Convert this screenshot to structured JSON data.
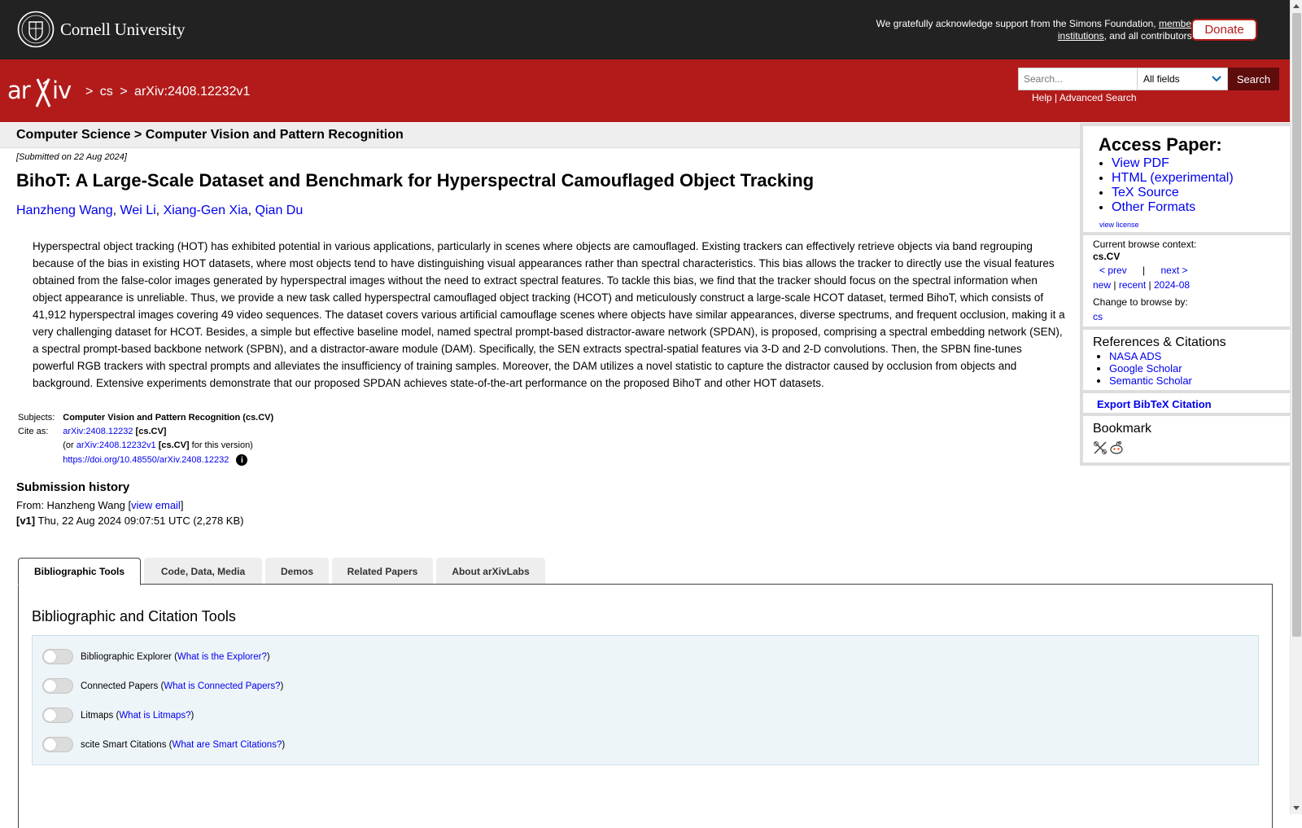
{
  "cornell": {
    "name": "Cornell University",
    "ack_prefix": "We gratefully acknowledge support from the Simons Foundation,",
    "ack_link": "member institutions",
    "ack_suffix": ", and all contributors.",
    "donate_label": "Donate"
  },
  "header": {
    "crumb_sep": ">",
    "crumb_cs": "cs",
    "crumb_id": "arXiv:2408.12232v1",
    "search_placeholder": "Search...",
    "search_field": "All fields",
    "search_button": "Search",
    "help": "Help",
    "help_sep": "|",
    "advanced": "Advanced Search"
  },
  "subheader": {
    "title": "Computer Science > Computer Vision and Pattern Recognition"
  },
  "paper": {
    "dateline": "[Submitted on 22 Aug 2024]",
    "title": "BihoT: A Large-Scale Dataset and Benchmark for Hyperspectral Camouflaged Object Tracking",
    "authors": [
      "Hanzheng Wang",
      "Wei Li",
      "Xiang-Gen Xia",
      "Qian Du"
    ],
    "author_sep": ",",
    "abstract": "Hyperspectral object tracking (HOT) has exhibited potential in various applications, particularly in scenes where objects are camouflaged. Existing trackers can effectively retrieve objects via band regrouping because of the bias in existing HOT datasets, where most objects tend to have distinguishing visual appearances rather than spectral characteristics. This bias allows the tracker to directly use the visual features obtained from the false-color images generated by hyperspectral images without the need to extract spectral features. To tackle this bias, we find that the tracker should focus on the spectral information when object appearance is unreliable. Thus, we provide a new task called hyperspectral camouflaged object tracking (HCOT) and meticulously construct a large-scale HCOT dataset, termed BihoT, which consists of 41,912 hyperspectral images covering 49 video sequences. The dataset covers various artificial camouflage scenes where objects have similar appearances, diverse spectrums, and frequent occlusion, making it a very challenging dataset for HCOT. Besides, a simple but effective baseline model, named spectral prompt-based distractor-aware network (SPDAN), is proposed, comprising a spectral embedding network (SEN), a spectral prompt-based backbone network (SPBN), and a distractor-aware module (DAM). Specifically, the SEN extracts spectral-spatial features via 3-D and 2-D convolutions. Then, the SPBN fine-tunes powerful RGB trackers with spectral prompts and alleviates the insufficiency of training samples. Moreover, the DAM utilizes a novel statistic to capture the distractor caused by occlusion from objects and background. Extensive experiments demonstrate that our proposed SPDAN achieves state-of-the-art performance on the proposed BihoT and other HOT datasets.",
    "subjects_label": "Subjects:",
    "subjects_value": "Computer Vision and Pattern Recognition (cs.CV)",
    "cite_label": "Cite as:",
    "cite_id": "arXiv:2408.12232",
    "cite_cat": "[cs.CV]",
    "cite_or_prefix": "(or",
    "cite_version_id": "arXiv:2408.12232v1",
    "cite_version_cat": "[cs.CV]",
    "cite_version_suffix": "for this version)",
    "doi": "https://doi.org/10.48550/arXiv.2408.12232",
    "history_title": "Submission history",
    "from_prefix": "From: Hanzheng Wang [",
    "view_email": "view email",
    "from_suffix": "]",
    "v1_tag": "[v1]",
    "v1_text": "Thu, 22 Aug 2024 09:07:51 UTC (2,278 KB)"
  },
  "sidebar": {
    "access_title": "Access Paper:",
    "access_links": [
      "View PDF",
      "HTML (experimental)",
      "TeX Source",
      "Other Formats"
    ],
    "view_license": "view license",
    "browse_context_label": "Current browse context:",
    "browse_context_value": "cs.CV",
    "prev": "< prev",
    "pipe": "|",
    "next": "next >",
    "new": "new",
    "recent": "recent",
    "month": "2024-08",
    "change_browse": "Change to browse by:",
    "browse_cs": "cs",
    "refs_title": "References & Citations",
    "refs": [
      "NASA ADS",
      "Google Scholar",
      "Semantic Scholar"
    ],
    "export_bibtex": "Export BibTeX Citation",
    "bookmark_title": "Bookmark"
  },
  "tabs": {
    "items": [
      "Bibliographic Tools",
      "Code, Data, Media",
      "Demos",
      "Related Papers",
      "About arXivLabs"
    ],
    "panel_title": "Bibliographic and Citation Tools",
    "tools": [
      {
        "name": "Bibliographic Explorer",
        "link": "What is the Explorer?"
      },
      {
        "name": "Connected Papers",
        "link": "What is Connected Papers?"
      },
      {
        "name": "Litmaps",
        "link": "What is Litmaps?"
      },
      {
        "name": "scite Smart Citations",
        "link": "What are Smart Citations?"
      }
    ]
  },
  "colors": {
    "arxiv_red": "#b31b1b",
    "cornell_black": "#222222",
    "link_blue": "#0000ee"
  }
}
